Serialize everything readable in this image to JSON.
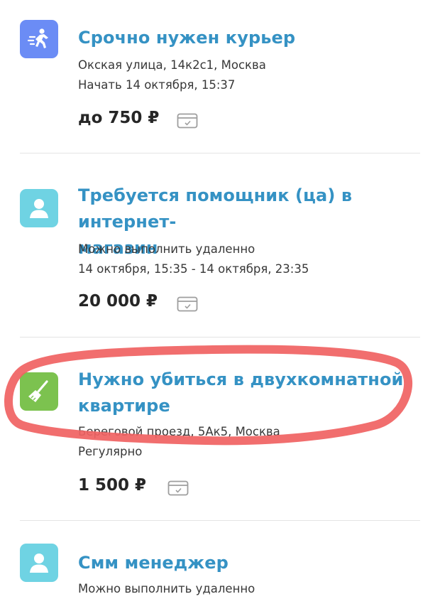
{
  "tasks": [
    {
      "icon": "courier-running-icon",
      "icon_color": "#6b8cf5",
      "title": "Срочно нужен курьер",
      "line1": "Окская улица, 14к2с1, Москва",
      "line2": "Начать 14 октября, 15:37",
      "price": "до 750 ₽",
      "payment_icon": "card-payment-icon"
    },
    {
      "icon": "person-icon",
      "icon_color": "#6fd3e3",
      "title_lines": [
        "Требуется помощник (ца) в интернет-",
        "магазин"
      ],
      "line1": "Можно выполнить удаленно",
      "line2": "14 октября, 15:35 - 14 октября, 23:35",
      "price": "20 000 ₽",
      "payment_icon": "card-payment-icon"
    },
    {
      "icon": "broom-icon",
      "icon_color": "#7cc24f",
      "title_lines": [
        "Нужно убиться в двухкомнатной",
        "квартире"
      ],
      "line1": "Береговой проезд, 5Ак5, Москва",
      "line2": "Регулярно",
      "price": "1 500 ₽",
      "payment_icon": "card-payment-icon",
      "highlight_color": "#f06262"
    },
    {
      "icon": "person-icon",
      "icon_color": "#6fd3e3",
      "title": "Смм менеджер",
      "line1": "Можно выполнить удаленно"
    }
  ]
}
